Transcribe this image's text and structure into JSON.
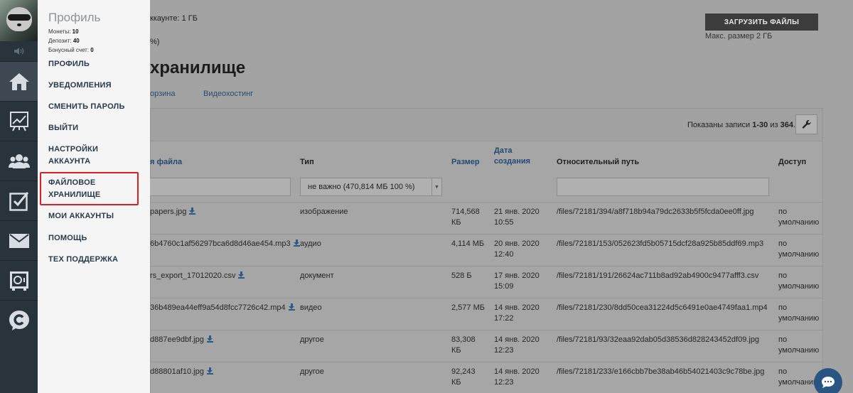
{
  "quota": {
    "line1": "ккаунте: 1 ГБ",
    "line2": "%)"
  },
  "upload_button": "ЗАГРУЗИТЬ ФАЙЛЫ",
  "max_size": "Макс. размер 2 ГБ",
  "page_title": "хранилище",
  "tabs": [
    {
      "label": "орзина"
    },
    {
      "label": "Видеохостинг"
    }
  ],
  "records": {
    "prefix": "Показаны записи ",
    "range": "1-30",
    "mid": " из ",
    "total": "364"
  },
  "columns": {
    "name": "я файла",
    "type": "Тип",
    "size": "Размер",
    "date_l1": "Дата",
    "date_l2": "создания",
    "path": "Относительный путь",
    "access": "Доступ"
  },
  "type_filter": "не важно (470,814 МБ 100 %)",
  "rows": [
    {
      "name": "papers.jpg",
      "type": "изображение",
      "size1": "714,568",
      "size2": "КБ",
      "date1": "21 янв. 2020",
      "date2": "10:55",
      "path": "/files/72181/394/a8f718b94a79dc2633b5f5fcda0ee0ff.jpg",
      "acc1": "по",
      "acc2": "умолчанию"
    },
    {
      "name": "6b4760c1af56297bca6d8d46ae454.mp3",
      "type": "аудио",
      "size1": "4,114 МБ",
      "size2": "",
      "date1": "20 янв. 2020",
      "date2": "12:40",
      "path": "/files/72181/153/052623fd5b05715dcf28a925b85ddf69.mp3",
      "acc1": "по",
      "acc2": "умолчанию"
    },
    {
      "name": "rs_export_17012020.csv",
      "type": "документ",
      "size1": "528 Б",
      "size2": "",
      "date1": "17 янв. 2020",
      "date2": "15:09",
      "path": "/files/72181/191/26624ac711b8ad92ab4900c9477afff3.csv",
      "acc1": "по",
      "acc2": "умолчанию"
    },
    {
      "name": "36b489ea44eff9a54d8fcc7726c42.mp4",
      "type": "видео",
      "size1": "2,577 МБ",
      "size2": "",
      "date1": "14 янв. 2020",
      "date2": "17:22",
      "path": "/files/72181/230/8dd50cea31224d5c6491e0ae4749faa1.mp4",
      "acc1": "по",
      "acc2": "умолчанию"
    },
    {
      "name": "d887ee9dbf.jpg",
      "type": "другое",
      "size1": "83,308",
      "size2": "КБ",
      "date1": "14 янв. 2020",
      "date2": "12:23",
      "path": "/files/72181/93/32eaa92dab05d38536d828243452df09.jpg",
      "acc1": "по",
      "acc2": "умолчанию"
    },
    {
      "name": "d88801af10.jpg",
      "type": "другое",
      "size1": "92,243",
      "size2": "КБ",
      "date1": "14 янв. 2020",
      "date2": "12:23",
      "path": "/files/72181/233/e166cbb7be38ab46b54021403c9c78be.jpg",
      "acc1": "по",
      "acc2": "умолчанию"
    }
  ],
  "profile": {
    "title": "Профиль",
    "coins_label": "Монеты: ",
    "coins": "10",
    "deposit_label": "Депозит: ",
    "deposit": "40",
    "bonus_label": "Бонусный счет: ",
    "bonus": "0"
  },
  "menu": [
    {
      "l1": "ПРОФИЛЬ",
      "l2": ""
    },
    {
      "l1": "УВЕДОМЛЕНИЯ",
      "l2": ""
    },
    {
      "l1": "СМЕНИТЬ ПАРОЛЬ",
      "l2": ""
    },
    {
      "l1": "ВЫЙТИ",
      "l2": ""
    },
    {
      "l1": "НАСТРОЙКИ",
      "l2": "АККАУНТА"
    },
    {
      "l1": "ФАЙЛОВОЕ",
      "l2": "ХРАНИЛИЩЕ"
    },
    {
      "l1": "МОИ АККАУНТЫ",
      "l2": ""
    },
    {
      "l1": "ПОМОЩЬ",
      "l2": ""
    },
    {
      "l1": "ТЕХ ПОДДЕРЖКА",
      "l2": ""
    }
  ],
  "icons": [
    "home-icon",
    "chart-icon",
    "users-icon",
    "checkbox-icon",
    "mail-icon",
    "safe-icon",
    "support-c-icon"
  ],
  "colors": {
    "sidebar": "#29333c",
    "dropdown": "#f5f5f5",
    "highlight": "#e02020",
    "link": "#234a73"
  }
}
